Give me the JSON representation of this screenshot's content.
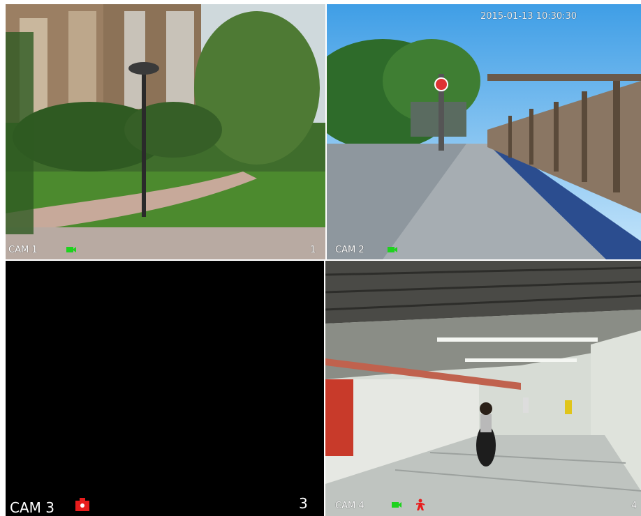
{
  "timestamp": "2015-01-13 10:30:30",
  "colors": {
    "record_ok": "#1ed21e",
    "alarm": "#e81c1c"
  },
  "channels": [
    {
      "name": "CAM 1",
      "index": "1",
      "status_icons": [
        "recording-icon"
      ]
    },
    {
      "name": "CAM 2",
      "index": "",
      "status_icons": [
        "recording-icon"
      ]
    },
    {
      "name": "CAM 3",
      "index": "3",
      "status_icons": [
        "video-loss-icon"
      ]
    },
    {
      "name": "CAM 4",
      "index": "4",
      "status_icons": [
        "recording-icon",
        "motion-alarm-icon"
      ]
    }
  ]
}
